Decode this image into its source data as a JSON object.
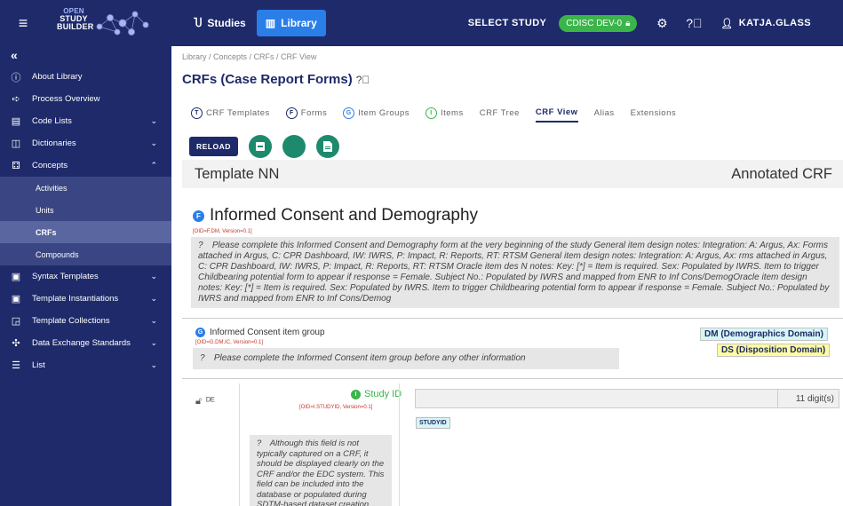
{
  "topbar": {
    "logo": {
      "line1": "OPEN",
      "line2": "STUDY",
      "line3": "BUILDER"
    },
    "studies_label": "Studies",
    "library_label": "Library",
    "select_study_label": "SELECT STUDY",
    "study_badge": "CDISC DEV-0",
    "user_label": "KATJA.GLASS"
  },
  "sidebar": {
    "collapse_glyph": "«",
    "items": [
      {
        "label": "About Library",
        "icon": "info-icon",
        "glyph": "ⓘ",
        "chevron": ""
      },
      {
        "label": "Process Overview",
        "icon": "arrow-right-icon",
        "glyph": "➪",
        "chevron": ""
      },
      {
        "label": "Code Lists",
        "icon": "list-box-icon",
        "glyph": "▤",
        "chevron": "⌄"
      },
      {
        "label": "Dictionaries",
        "icon": "book-icon",
        "glyph": "◫",
        "chevron": "⌄"
      },
      {
        "label": "Concepts",
        "icon": "hierarchy-icon",
        "glyph": "⚃",
        "chevron": "⌃"
      }
    ],
    "sub_items": [
      {
        "label": "Activities",
        "active": false
      },
      {
        "label": "Units",
        "active": false
      },
      {
        "label": "CRFs",
        "active": true
      },
      {
        "label": "Compounds",
        "active": false
      }
    ],
    "items2": [
      {
        "label": "Syntax Templates",
        "icon": "template-icon",
        "glyph": "▣",
        "chevron": "⌄"
      },
      {
        "label": "Template Instantiations",
        "icon": "instance-icon",
        "glyph": "▣",
        "chevron": "⌄"
      },
      {
        "label": "Template Collections",
        "icon": "collection-icon",
        "glyph": "◲",
        "chevron": "⌄"
      },
      {
        "label": "Data Exchange Standards",
        "icon": "exchange-icon",
        "glyph": "✣",
        "chevron": "⌄"
      },
      {
        "label": "List",
        "icon": "list-icon",
        "glyph": "☰",
        "chevron": "⌄"
      }
    ]
  },
  "main": {
    "breadcrumb": "Library / Concepts / CRFs / CRF View",
    "title": "CRFs (Case Report Forms)",
    "tabs": [
      {
        "label": "CRF Templates",
        "dot": "T",
        "dot_class": ""
      },
      {
        "label": "Forms",
        "dot": "F",
        "dot_class": ""
      },
      {
        "label": "Item Groups",
        "dot": "G",
        "dot_class": "b"
      },
      {
        "label": "Items",
        "dot": "I",
        "dot_class": "g"
      },
      {
        "label": "CRF Tree",
        "dot": "",
        "dot_class": ""
      },
      {
        "label": "CRF View",
        "dot": "",
        "dot_class": "",
        "active": true
      },
      {
        "label": "Alias",
        "dot": "",
        "dot_class": ""
      },
      {
        "label": "Extensions",
        "dot": "",
        "dot_class": ""
      }
    ],
    "reload_label": "RELOAD",
    "crf_header_left": "Template NN",
    "crf_header_right": "Annotated CRF",
    "form": {
      "title": "Informed Consent and Demography",
      "oid": "[OID=F.DM, Version=0.1]",
      "note": "Please complete this Informed Consent and Demography form at the very beginning of the study General item design notes: Integration: A: Argus, Ax: Forms attached in Argus, C: CPR Dashboard, IW: IWRS, P: Impact, R: Reports, RT: RTSM General item design notes: Integration: A: Argus, Ax: rms attached in Argus, C: CPR Dashboard, IW: IWRS, P: Impact, R: Reports, RT: RTSM Oracle item des N notes: Key: [*] = Item is required. Sex: Populated by IWRS. Item to trigger Childbearing potential form to appear if response = Female. Subject No.: Populated by IWRS and mapped from ENR to Inf Cons/DemogOracle item design notes: Key: [*] = Item is required. Sex: Populated by IWRS. Item to trigger Childbearing potential form to appear if response = Female. Subject No.: Populated by IWRS and mapped from ENR to Inf Cons/Demog"
    },
    "group": {
      "title": "Informed Consent item group",
      "oid": "[OID=G.DM.IC, Version=0.1]",
      "note": "Please complete the Informed Consent item group before any other information",
      "domain_dm": "DM (Demographics Domain)",
      "domain_ds": "DS (Disposition Domain)"
    },
    "item": {
      "label": "Study ID",
      "oid": "[OID=I.STUDYID, Version=0.1]",
      "digits": "11 digit(s)",
      "badge": "STUDYID",
      "note": "Although this field is not typically captured on a CRF, it should be displayed clearly on the CRF and/or the EDC system. This field can be included into the database or populated during SDTM-based dataset creation before submission."
    }
  }
}
